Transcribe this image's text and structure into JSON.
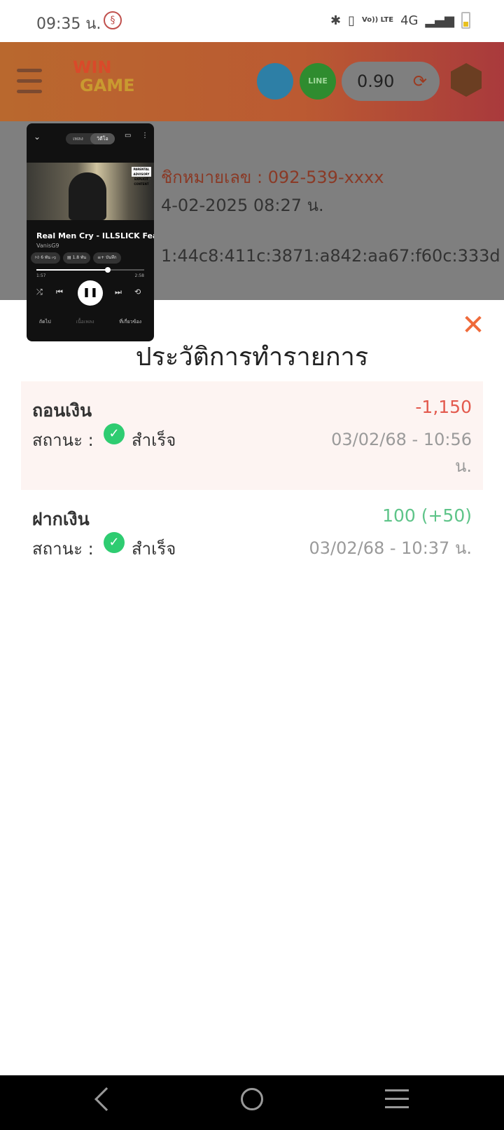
{
  "status_bar": {
    "time": "09:35 น.",
    "network": "4G",
    "volte": "Vo)) LTE"
  },
  "header": {
    "logo_top": "WIN",
    "logo_bottom": "GAME",
    "line_label": "LINE",
    "balance": "0.90",
    "icons": [
      "menu-icon",
      "telegram-icon",
      "line-icon",
      "refresh-icon",
      "rank-badge-icon"
    ]
  },
  "background": {
    "phone_text": "ชิกหมายเลข : 092-539-xxxx",
    "date_text": "4-02-2025 08:27 น.",
    "ip_text": "1:44c8:411c:3871:a842:aa67:f60c:333d"
  },
  "mini_player": {
    "tab_song": "เพลง",
    "tab_video": "วิดีโอ",
    "song_title": "Real Men Cry - ILLSLICK Feat",
    "artist": "VanisG9",
    "chip_like": "6 พัน",
    "chip_comments": "1.8 พัน",
    "chip_save": "บันทึก",
    "progress": 0.66,
    "time_elapsed": "1:57",
    "time_total": "2:58",
    "bottom_next": "ถัดไป",
    "bottom_lyrics": "เนื้อเพลง",
    "bottom_related": "ที่เกี่ยวข้อง",
    "advisory": "PARENTAL ADVISORY EXPLICIT CONTENT"
  },
  "modal": {
    "title": "ประวัติการทำรายการ",
    "close_glyph": "✕",
    "transactions": [
      {
        "type": "ถอนเงิน",
        "amount": "-1,150",
        "status_label": "สถานะ :",
        "status": "สำเร็จ",
        "time": "03/02/68 - 10:56 น."
      },
      {
        "type": "ฝากเงิน",
        "amount": "100 (+50)",
        "status_label": "สถานะ :",
        "status": "สำเร็จ",
        "time": "03/02/68 - 10:37 น."
      }
    ]
  },
  "colors": {
    "header_gradient_start": "#b9682e",
    "header_gradient_end": "#a93a3c",
    "close": "#ef6a3a",
    "negative_amount": "#e35a4e",
    "positive_amount": "#5ec489",
    "success_check": "#2ecc71",
    "withdraw_row_bg": "#fdf4f2"
  }
}
